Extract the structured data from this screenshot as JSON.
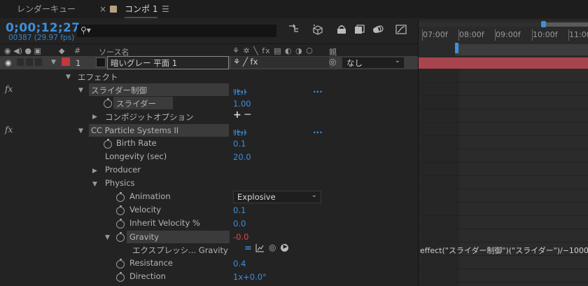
{
  "tabs": [
    {
      "label": "レンダーキュー",
      "active": false
    },
    {
      "label": "コンポ 1",
      "active": true
    }
  ],
  "tab_close_glyph": "×",
  "tab_menu_glyph": "☰",
  "timecode": "0;00;12;27",
  "frame_count": "00387 (29.97 fps)",
  "search_glyph": "⚲▾",
  "toolbar_icons": [
    "comp-flowchart-icon",
    "draft-3d-icon",
    "shy-layers-icon",
    "frame-blending-icon",
    "motion-blur-icon",
    "graph-editor-icon"
  ],
  "ruler_labels": [
    "07:00f",
    "08:00f",
    "09:00f",
    "10:00f",
    "11:00f"
  ],
  "columns": {
    "index": "#",
    "source_name": "ソース名",
    "parent": "親",
    "switch_icons": "⚘ ✲ ╲ fx ▤ ◐ ◑ ⬡"
  },
  "layer": {
    "number": "1",
    "name": "暗いグレー 平面 1",
    "label_color": "#c0393b",
    "parent_value": "なし",
    "switches": "⚘ ╱ fx"
  },
  "effects_label": "エフェクト",
  "slider_effect": {
    "name": "スライダー制御",
    "reset": "ﾘｾｯﾄ",
    "more": "...",
    "prop_label": "スライダー",
    "prop_value": "1.00",
    "extra": "+ ─"
  },
  "compositing_label": "コンポジットオプション",
  "ccp": {
    "name": "CC Particle Systems II",
    "reset": "ﾘｾｯﾄ",
    "more": "...",
    "birth_rate_label": "Birth Rate",
    "birth_rate": "0.1",
    "longevity_label": "Longevity (sec)",
    "longevity": "20.0",
    "producer_label": "Producer",
    "physics_label": "Physics",
    "animation_label": "Animation",
    "animation": "Explosive",
    "velocity_label": "Velocity",
    "velocity": "0.1",
    "inherit_label": "Inherit Velocity %",
    "inherit": "0.0",
    "gravity_label": "Gravity",
    "gravity": "-0.0",
    "expression_label": "エクスプレッシ... Gravity",
    "expression": "effect(\"スライダー制御\")(\"スライダー\")/−1000",
    "resistance_label": "Resistance",
    "resistance": "0.4",
    "direction_label": "Direction",
    "direction": "1x+0.0°"
  },
  "colors": {
    "accent": "#3c8fe0",
    "layer_bar": "#a8444d",
    "error_value": "#e04a4a"
  }
}
